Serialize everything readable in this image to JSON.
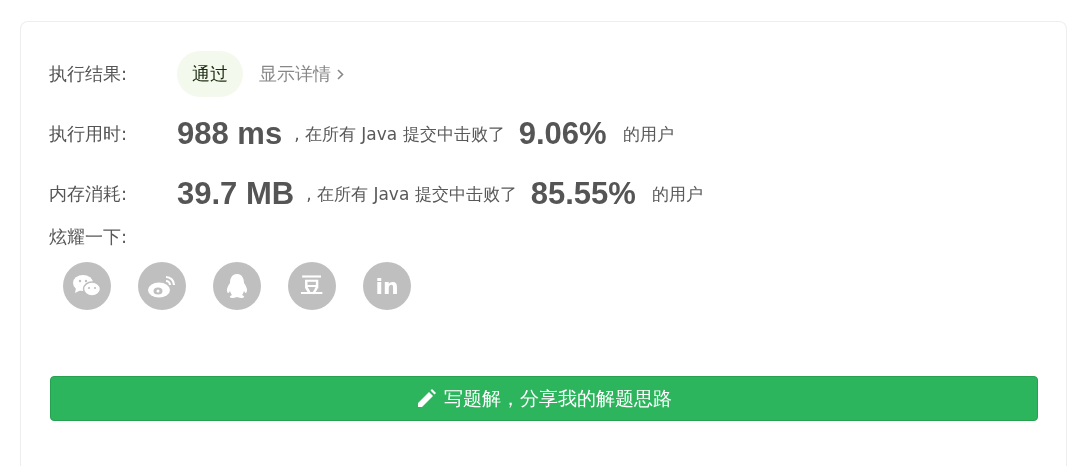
{
  "result": {
    "label": "执行结果:",
    "status": "通过",
    "details_link": "显示详情"
  },
  "stats": [
    {
      "label": "执行用时:",
      "value": "988 ms",
      "middle": ", 在所有 Java 提交中击败了",
      "percent": "9.06%",
      "suffix": "的用户"
    },
    {
      "label": "内存消耗:",
      "value": "39.7 MB",
      "middle": ", 在所有 Java 提交中击败了",
      "percent": "85.55%",
      "suffix": "的用户"
    }
  ],
  "share": {
    "label": "炫耀一下:",
    "buttons": [
      {
        "kind": "wechat"
      },
      {
        "kind": "weibo"
      },
      {
        "kind": "qq"
      },
      {
        "kind": "glyph",
        "glyph": "豆"
      },
      {
        "kind": "glyph",
        "glyph": "in"
      }
    ]
  },
  "action_button": {
    "label": "写题解，分享我的解题思路"
  }
}
